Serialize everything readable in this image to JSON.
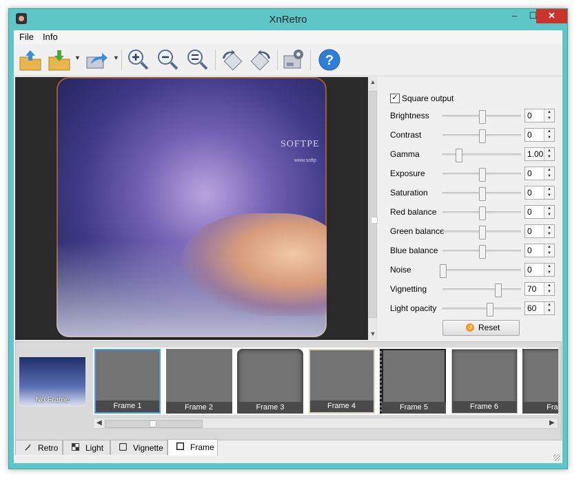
{
  "window": {
    "title": "XnRetro",
    "minimize": "–",
    "maximize": "☐",
    "close": "✕"
  },
  "menu": [
    {
      "label": "File"
    },
    {
      "label": "Info"
    }
  ],
  "toolbar": [
    {
      "icon": "open-folder-icon"
    },
    {
      "icon": "save-folder-icon"
    },
    {
      "icon": "share-export-icon"
    },
    {
      "icon": "zoom-in-icon"
    },
    {
      "icon": "zoom-out-icon"
    },
    {
      "icon": "zoom-fit-icon"
    },
    {
      "icon": "rotate-left-icon"
    },
    {
      "icon": "rotate-right-icon"
    },
    {
      "icon": "screen-capture-icon"
    },
    {
      "icon": "help-icon"
    }
  ],
  "preview": {
    "watermark": "SOFTPE",
    "watermark_small": "www.softp"
  },
  "settings": {
    "square_output": {
      "label": "Square output",
      "checked": true
    },
    "sliders": [
      {
        "label": "Brightness",
        "value": "0",
        "pos": 0.5
      },
      {
        "label": "Contrast",
        "value": "0",
        "pos": 0.5
      },
      {
        "label": "Gamma",
        "value": "1.00",
        "pos": 0.2
      },
      {
        "label": "Exposure",
        "value": "0",
        "pos": 0.5
      },
      {
        "label": "Saturation",
        "value": "0",
        "pos": 0.5
      },
      {
        "label": "Red balance",
        "value": "0",
        "pos": 0.5
      },
      {
        "label": "Green balance",
        "value": "0",
        "pos": 0.5
      },
      {
        "label": "Blue balance",
        "value": "0",
        "pos": 0.5
      },
      {
        "label": "Noise",
        "value": "0",
        "pos": 0.0
      },
      {
        "label": "Vignetting",
        "value": "70",
        "pos": 0.7
      },
      {
        "label": "Light opacity",
        "value": "60",
        "pos": 0.6
      }
    ],
    "reset_label": "Reset"
  },
  "frames": {
    "no_frame": "No Frame",
    "items": [
      "Frame 1",
      "Frame 2",
      "Frame 3",
      "Frame 4",
      "Frame 5",
      "Frame 6",
      "Fram"
    ],
    "selected": 0
  },
  "tabs": [
    {
      "label": "Retro",
      "icon": "wand-icon",
      "active": false
    },
    {
      "label": "Light",
      "icon": "light-icon",
      "active": false
    },
    {
      "label": "Vignette",
      "icon": "vignette-icon",
      "active": false
    },
    {
      "label": "Frame",
      "icon": "frame-icon",
      "active": true
    }
  ]
}
